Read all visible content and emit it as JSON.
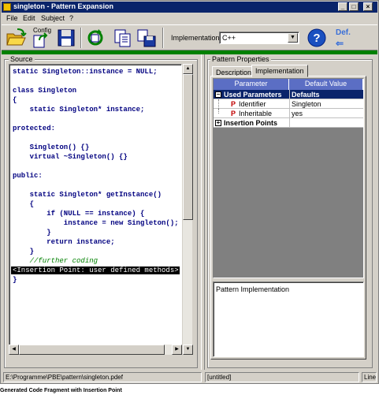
{
  "window": {
    "title": "singleton - Pattern Expansion",
    "minimize": "_",
    "maximize": "□",
    "close": "×"
  },
  "menu": [
    "File",
    "Edit",
    "Subject",
    "?"
  ],
  "toolbar": {
    "config_label": "Config",
    "implementation_label": "Implementation",
    "implementation_value": "C++",
    "default_label": "Def.",
    "default_arrow": "⇐"
  },
  "source": {
    "title": "Source",
    "lines": [
      "static Singleton::instance = NULL;",
      "",
      "class Singleton",
      "{",
      "    static Singleton* instance;",
      "",
      "protected:",
      "",
      "    Singleton() {}",
      "    virtual ~Singleton() {}",
      "",
      "public:",
      "",
      "    static Singleton* getInstance()",
      "    {",
      "        if (NULL == instance) {",
      "            instance = new Singleton();",
      "        }",
      "        return instance;",
      "    }",
      "    //further coding",
      "<Insertion Point: user defined methods>",
      "}"
    ]
  },
  "properties": {
    "title": "Pattern Properties",
    "tabs": [
      "Description",
      "Implementation"
    ],
    "grid": {
      "headers": [
        "Parameter",
        "Default Value"
      ],
      "rows": [
        {
          "name": "Used Parameters",
          "value": "Defaults",
          "expander": "−"
        },
        {
          "name": "Identifier",
          "value": "Singleton",
          "icon": "P"
        },
        {
          "name": "Inheritable",
          "value": "yes",
          "icon": "P"
        },
        {
          "name": "Insertion Points",
          "value": "",
          "expander": "+"
        }
      ]
    },
    "implementation_box": "Pattern Implementation"
  },
  "status": {
    "path": "E:\\Programme\\PBE\\pattern\\singleton.pdef",
    "doc": "[untitled]",
    "lang": "Line"
  },
  "caption": "Generated Code Fragment with Insertion Point"
}
